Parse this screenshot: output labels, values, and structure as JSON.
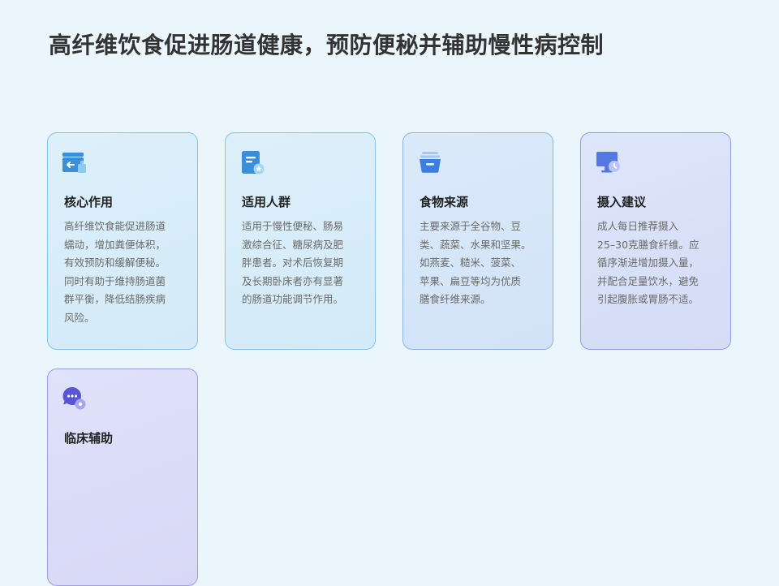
{
  "title": "高纤维饮食促进肠道健康，预防便秘并辅助慢性病控制",
  "cards": [
    {
      "icon": "inbox-tray-icon",
      "title": "核心作用",
      "lines": [
        "高纤维饮食能促进肠道",
        "蠕动，增加粪便体积，",
        "有效预防和缓解便秘。",
        "同时有助于维持肠道菌",
        "群平衡，降低结肠疾病",
        "风险。"
      ]
    },
    {
      "icon": "document-star-icon",
      "title": "适用人群",
      "lines": [
        "适用于慢性便秘、肠易",
        "激综合征、糖尿病及肥",
        "胖患者。对术后恢复期",
        "及长期卧床者亦有显著",
        "的肠道功能调节作用。"
      ]
    },
    {
      "icon": "food-basket-icon",
      "title": "食物来源",
      "lines": [
        "主要来源于全谷物、豆",
        "类、蔬菜、水果和坚果。",
        "如燕麦、糙米、菠菜、",
        "苹果、扁豆等均为优质",
        "膳食纤维来源。"
      ]
    },
    {
      "icon": "monitor-clock-icon",
      "title": "摄入建议",
      "lines": [
        "成人每日推荐摄入",
        "25–30克膳食纤维。应",
        "循序渐进增加摄入量，",
        "并配合足量饮水，避免",
        "引起腹胀或胃肠不适。"
      ]
    },
    {
      "icon": "chat-gear-icon",
      "title": "临床辅助",
      "lines": []
    }
  ]
}
